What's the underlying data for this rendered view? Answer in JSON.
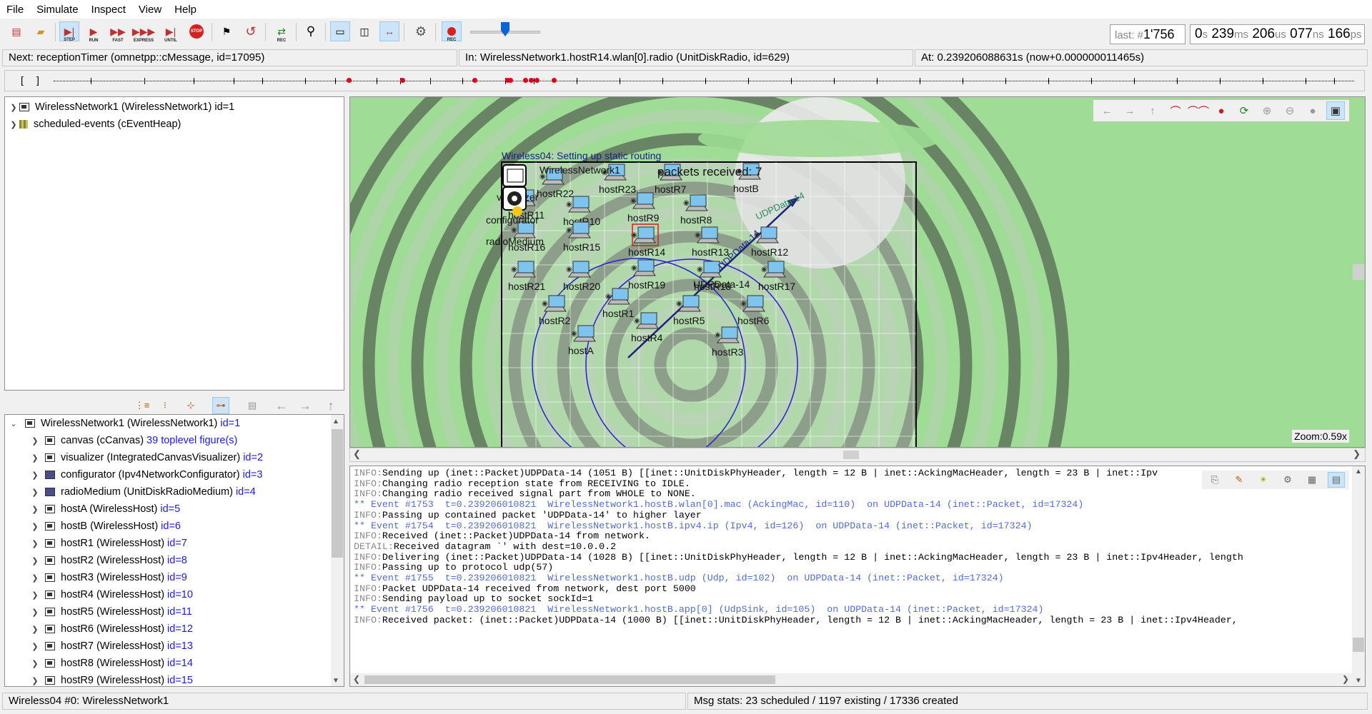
{
  "menu": [
    "File",
    "Simulate",
    "Inspect",
    "View",
    "Help"
  ],
  "toolbar": {
    "step": "STEP",
    "run": "RUN",
    "fast": "FAST",
    "express": "EXPRESS",
    "until": "UNTIL",
    "stop": "STOP",
    "rec": "REC"
  },
  "counter": {
    "last_label": "last: #",
    "last_value": "1'756"
  },
  "simtime": [
    {
      "v": "0",
      "u": "s"
    },
    {
      "v": "239",
      "u": "ms"
    },
    {
      "v": "206",
      "u": "us"
    },
    {
      "v": "077",
      "u": "ns"
    },
    {
      "v": "166",
      "u": "ps"
    }
  ],
  "status": {
    "next": "Next: receptionTimer (omnetpp::cMessage, id=17095)",
    "in": "In: WirelessNetwork1.hostR14.wlan[0].radio (UnitDiskRadio, id=629)",
    "at": "At: 0.239206088631s (now+0.000000011465s)"
  },
  "timeline": {
    "open": "[",
    "close": "]"
  },
  "tree_top": [
    {
      "label": "WirelessNetwork1 (WirelessNetwork1) id=1",
      "icon": "module-icon"
    },
    {
      "label": "scheduled-events (cEventHeap)",
      "icon": "heap-icon"
    }
  ],
  "tree_bottom": {
    "root": {
      "label": "WirelessNetwork1 (WirelessNetwork1)",
      "id": "id=1"
    },
    "items": [
      {
        "label": "canvas (cCanvas)",
        "extra": "39 toplevel figure(s)",
        "icon": "module-icon"
      },
      {
        "label": "visualizer (IntegratedCanvasVisualizer)",
        "extra": "id=2",
        "icon": "module-icon"
      },
      {
        "label": "configurator (Ipv4NetworkConfigurator)",
        "extra": "id=3",
        "icon": "small-module-icon"
      },
      {
        "label": "radioMedium (UnitDiskRadioMedium)",
        "extra": "id=4",
        "icon": "small-module-icon"
      },
      {
        "label": "hostA (WirelessHost)",
        "extra": "id=5",
        "icon": "module-icon"
      },
      {
        "label": "hostB (WirelessHost)",
        "extra": "id=6",
        "icon": "module-icon"
      },
      {
        "label": "hostR1 (WirelessHost)",
        "extra": "id=7",
        "icon": "module-icon"
      },
      {
        "label": "hostR2 (WirelessHost)",
        "extra": "id=8",
        "icon": "module-icon"
      },
      {
        "label": "hostR3 (WirelessHost)",
        "extra": "id=9",
        "icon": "module-icon"
      },
      {
        "label": "hostR4 (WirelessHost)",
        "extra": "id=10",
        "icon": "module-icon"
      },
      {
        "label": "hostR5 (WirelessHost)",
        "extra": "id=11",
        "icon": "module-icon"
      },
      {
        "label": "hostR6 (WirelessHost)",
        "extra": "id=12",
        "icon": "module-icon"
      },
      {
        "label": "hostR7 (WirelessHost)",
        "extra": "id=13",
        "icon": "module-icon"
      },
      {
        "label": "hostR8 (WirelessHost)",
        "extra": "id=14",
        "icon": "module-icon"
      },
      {
        "label": "hostR9 (WirelessHost)",
        "extra": "id=15",
        "icon": "module-icon"
      }
    ]
  },
  "canvas": {
    "title": "Wireless04: Setting up static routing",
    "network_label": "WirelessNetwork1",
    "packets_received": "packets received: 7",
    "visualizer_label": "visualizer",
    "configurator_label": "configurator",
    "radiomedium_label": "radioMedium",
    "zoom": "Zoom:0.59x",
    "packet_label": "UDPData-14",
    "hosts": [
      "hostR22",
      "hostR23",
      "hostR7",
      "hostB",
      "hostR11",
      "hostR10",
      "hostR9",
      "hostR8",
      "hostR16",
      "hostR15",
      "hostR14",
      "hostR13",
      "hostR12",
      "hostR21",
      "hostR20",
      "hostR19",
      "hostR18",
      "hostR17",
      "hostR2",
      "hostR1",
      "hostR5",
      "hostR6",
      "hostA",
      "hostR4",
      "hostR3"
    ]
  },
  "log": [
    {
      "lvl": "INFO:",
      "text": "Sending up (inet::Packet)UDPData-14 (1051 B) [[inet::UnitDiskPhyHeader, length = 12 B | inet::AckingMacHeader, length = 23 B | inet::Ipv"
    },
    {
      "lvl": "INFO:",
      "text": "Changing radio reception state from RECEIVING to IDLE."
    },
    {
      "lvl": "INFO:",
      "text": "Changing radio received signal part from WHOLE to NONE."
    },
    {
      "lvl": "",
      "text": "** Event #1753  t=0.239206010821  WirelessNetwork1.hostB.wlan[0].mac (AckingMac, id=110)  on UDPData-14 (inet::Packet, id=17324)",
      "ev": true
    },
    {
      "lvl": "INFO:",
      "text": "Passing up contained packet 'UDPData-14' to higher layer"
    },
    {
      "lvl": "",
      "text": "** Event #1754  t=0.239206010821  WirelessNetwork1.hostB.ipv4.ip (Ipv4, id=126)  on UDPData-14 (inet::Packet, id=17324)",
      "ev": true
    },
    {
      "lvl": "INFO:",
      "text": "Received (inet::Packet)UDPData-14 from network."
    },
    {
      "lvl": "DETAIL:",
      "text": "Received datagram `' with dest=10.0.0.2"
    },
    {
      "lvl": "INFO:",
      "text": "Delivering (inet::Packet)UDPData-14 (1028 B) [[inet::UnitDiskPhyHeader, length = 12 B | inet::AckingMacHeader, length = 23 B | inet::Ipv4Header, length"
    },
    {
      "lvl": "INFO:",
      "text": "Passing up to protocol udp(57)"
    },
    {
      "lvl": "",
      "text": "** Event #1755  t=0.239206010821  WirelessNetwork1.hostB.udp (Udp, id=102)  on UDPData-14 (inet::Packet, id=17324)",
      "ev": true
    },
    {
      "lvl": "INFO:",
      "text": "Packet UDPData-14 received from network, dest port 5000"
    },
    {
      "lvl": "INFO:",
      "text": "Sending payload up to socket sockId=1"
    },
    {
      "lvl": "",
      "text": "** Event #1756  t=0.239206010821  WirelessNetwork1.hostB.app[0] (UdpSink, id=105)  on UDPData-14 (inet::Packet, id=17324)",
      "ev": true
    },
    {
      "lvl": "INFO:",
      "text": "Received packet: (inet::Packet)UDPData-14 (1000 B) [[inet::UnitDiskPhyHeader, length = 12 B | inet::AckingMacHeader, length = 23 B | inet::Ipv4Header,"
    }
  ],
  "bottom": {
    "left": "Wireless04 #0: WirelessNetwork1",
    "right": "Msg stats: 23 scheduled / 1197 existing / 17336 created"
  }
}
